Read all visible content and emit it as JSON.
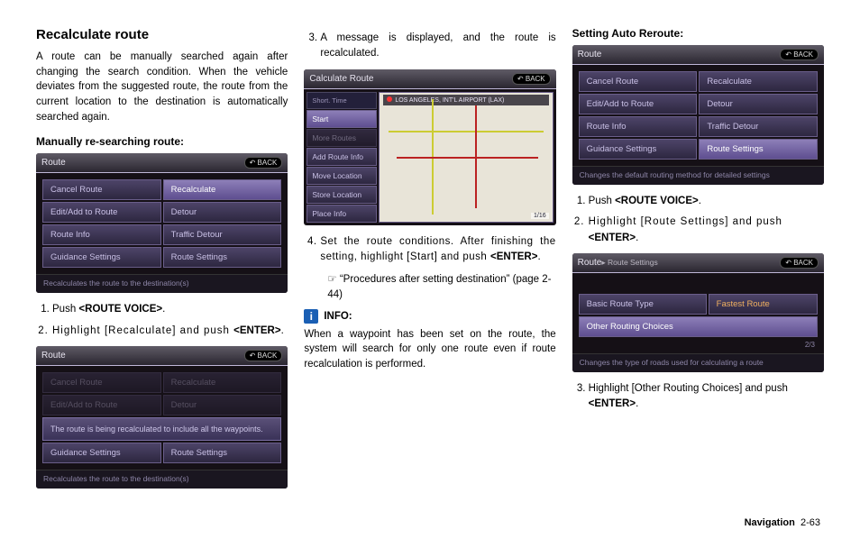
{
  "footer": {
    "section": "Navigation",
    "page": "2-63"
  },
  "col1": {
    "heading": "Recalculate route",
    "intro": "A route can be manually searched again after changing the search condition. When the vehicle deviates from the suggested route, the route from the current location to the destination is automatically searched again.",
    "subheading": "Manually re-searching route:",
    "step1": "Push ",
    "step1_key": "<ROUTE VOICE>",
    "step1_tail": ".",
    "step2a": "Highlight [Recalculate] and push ",
    "step2_key": "<ENTER>",
    "step2_tail": "."
  },
  "shot_route_menu": {
    "title": "Route",
    "back": "BACK",
    "rows": [
      [
        "Cancel Route",
        "Recalculate"
      ],
      [
        "Edit/Add to Route",
        "Detour"
      ],
      [
        "Route Info",
        "Traffic Detour"
      ],
      [
        "Guidance Settings",
        "Route Settings"
      ]
    ],
    "highlight": [
      0,
      1
    ],
    "status": "Recalculates the route to the destination(s)"
  },
  "shot_route_msg": {
    "title": "Route",
    "back": "BACK",
    "dim_rows": [
      [
        "Cancel Route",
        "Recalculate"
      ],
      [
        "Edit/Add to Route",
        "Detour"
      ]
    ],
    "msg": "The route is being recalculated to include all the waypoints.",
    "bottom_row": [
      "Guidance Settings",
      "Route Settings"
    ],
    "status": "Recalculates the route to the destination(s)"
  },
  "col2": {
    "step3": "A message is displayed, and the route is recalculated.",
    "step4a": "Set the route conditions. After finishing the setting, highlight [Start] and push ",
    "step4_key": "<ENTER>",
    "step4_tail": ".",
    "ref_icon": "☞",
    "ref": "“Procedures after setting destination” (page 2-44)",
    "info_label": "INFO:",
    "info_body": "When a waypoint has been set on the route, the system will search for only one route even if route recalculation is performed."
  },
  "shot_calc": {
    "title": "Calculate Route",
    "back": "BACK",
    "top": "Short. Time",
    "items": [
      "Start",
      "More Routes",
      "Add Route Info",
      "Move Location",
      "Store Location",
      "Place Info"
    ],
    "highlight": 0,
    "map_label": "LOS ANGELES, INT'L AIRPORT (LAX)",
    "scale": "1/16"
  },
  "col3": {
    "subheading": "Setting Auto Reroute:",
    "step1": "Push ",
    "step1_key": "<ROUTE VOICE>",
    "step1_tail": ".",
    "step2a": "Highlight [Route Settings] and push ",
    "step2_key": "<ENTER>",
    "step2_tail": ".",
    "step3a": "Highlight [Other Routing Choices] and push ",
    "step3_key": "<ENTER>",
    "step3_tail": "."
  },
  "shot_route_settings_menu": {
    "title": "Route",
    "back": "BACK",
    "rows": [
      [
        "Cancel Route",
        "Recalculate"
      ],
      [
        "Edit/Add to Route",
        "Detour"
      ],
      [
        "Route Info",
        "Traffic Detour"
      ],
      [
        "Guidance Settings",
        "Route Settings"
      ]
    ],
    "highlight": [
      3,
      1
    ],
    "status": "Changes the default routing method for detailed settings"
  },
  "shot_route_settings_sub": {
    "title_a": "Route",
    "title_b": "Route Settings",
    "back": "BACK",
    "row1_left": "Basic Route Type",
    "row1_right": "Fastest Route",
    "row2": "Other Routing Choices",
    "page": "2/3",
    "status": "Changes the type of roads used for calculating a route"
  }
}
